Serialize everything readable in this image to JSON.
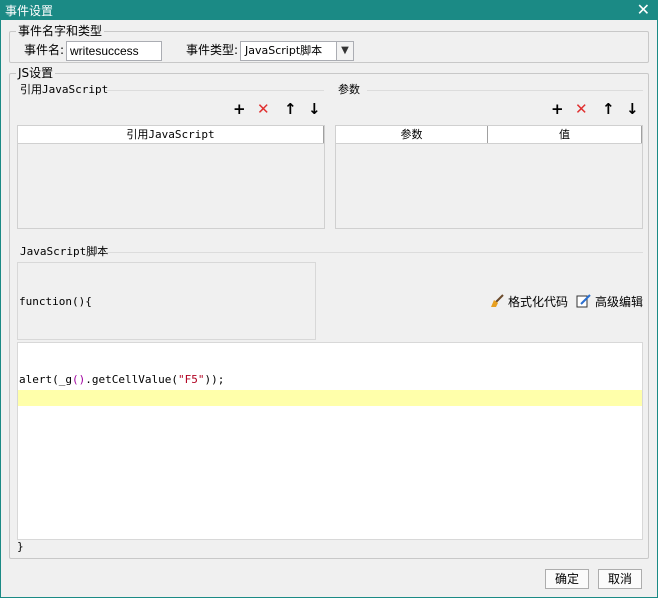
{
  "window": {
    "title": "事件设置",
    "close_glyph": "✕"
  },
  "event_group": {
    "legend": "事件名字和类型",
    "name_label": "事件名:",
    "name_value": "writesuccess",
    "type_label": "事件类型:",
    "type_value": "JavaScript脚本"
  },
  "js_group": {
    "legend": "JS设置",
    "ref_section": {
      "title": "引用JavaScript",
      "columns": [
        "引用JavaScript"
      ]
    },
    "param_section": {
      "title": "参数",
      "columns": [
        "参数",
        "值"
      ]
    },
    "toolbar_icons": [
      "plus-icon",
      "delete-icon",
      "arrow-up-icon",
      "arrow-down-icon"
    ],
    "toolbar_glyphs": {
      "add": "+",
      "delete": "✕",
      "up": "↑",
      "down": "↓"
    },
    "script_section": {
      "title": "JavaScript脚本",
      "function_header": "function(){",
      "format_label": "格式化代码",
      "advanced_label": "高级编辑",
      "code": {
        "ident": "alert(",
        "call": "_g",
        "parens": "()",
        "method": ".getCellValue(",
        "arg": "\"F5\"",
        "tail": "));"
      },
      "function_footer": "}"
    }
  },
  "footer": {
    "ok_label": "确定",
    "cancel_label": "取消"
  },
  "colors": {
    "titlebar": "#1b8a85",
    "delete_red": "#e03030",
    "highlight": "#ffffaa"
  }
}
